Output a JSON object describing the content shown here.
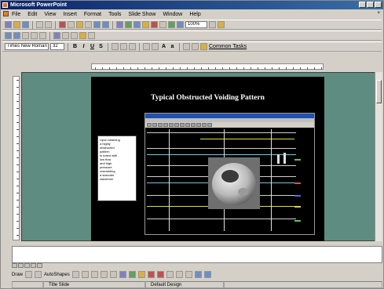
{
  "window": {
    "title": "Microsoft PowerPoint"
  },
  "menu": [
    "File",
    "Edit",
    "View",
    "Insert",
    "Format",
    "Tools",
    "Slide Show",
    "Window",
    "Help"
  ],
  "toolbar": {
    "zoom": "100%",
    "font": "Times New Roman",
    "font_size": "32",
    "common_tasks": "Common Tasks"
  },
  "slide": {
    "title": "Typical Obstructed Voiding Pattern",
    "caption_lines": [
      "Upon straining",
      "a highly",
      "obstructed",
      "pattern",
      "is noted with",
      "low flow",
      "and high",
      "pressure",
      "resembling",
      "a staccato",
      "waveform"
    ]
  },
  "drawing_toolbar": {
    "draw_label": "Draw",
    "autoshapes_label": "AutoShapes"
  },
  "status": {
    "slide_info": "Title Slide",
    "design": "Default Design"
  }
}
